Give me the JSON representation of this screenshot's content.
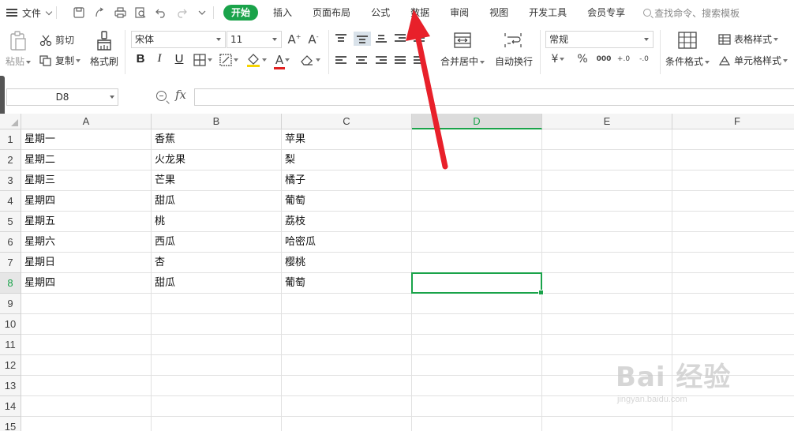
{
  "menubar": {
    "file_label": "文件",
    "tabs": [
      "开始",
      "插入",
      "页面布局",
      "公式",
      "数据",
      "审阅",
      "视图",
      "开发工具",
      "会员专享"
    ],
    "search_placeholder": "查找命令、搜索模板"
  },
  "ribbon": {
    "paste_label": "粘贴",
    "cut_label": "剪切",
    "copy_label": "复制",
    "format_painter_label": "格式刷",
    "font_name": "宋体",
    "font_size": "11",
    "bold": "B",
    "italic": "I",
    "underline": "U",
    "font_color_glyph": "A",
    "grow_font": "A+",
    "shrink_font": "A-",
    "merge_label": "合并居中",
    "wrap_label": "自动换行",
    "number_format": "常规",
    "currency_glyph": "¥",
    "percent_glyph": "%",
    "thousands_glyph": "000",
    "inc_decimal_glyph": "+.0",
    "dec_decimal_glyph": "-.0",
    "cond_format_label": "条件格式",
    "table_style_label": "表格样式",
    "cell_style_label": "单元格样式"
  },
  "formula_bar": {
    "name_box": "D8",
    "fx_glyph": "fx",
    "formula": ""
  },
  "sheet": {
    "columns": [
      "A",
      "B",
      "C",
      "D",
      "E",
      "F"
    ],
    "active_column": "D",
    "rows": [
      {
        "num": "1",
        "cells": [
          "星期一",
          "香蕉",
          "苹果"
        ]
      },
      {
        "num": "2",
        "cells": [
          "星期二",
          "火龙果",
          "梨"
        ]
      },
      {
        "num": "3",
        "cells": [
          "星期三",
          "芒果",
          "橘子"
        ]
      },
      {
        "num": "4",
        "cells": [
          "星期四",
          "甜瓜",
          "葡萄"
        ]
      },
      {
        "num": "5",
        "cells": [
          "星期五",
          "桃",
          "荔枝"
        ]
      },
      {
        "num": "6",
        "cells": [
          "星期六",
          "西瓜",
          "哈密瓜"
        ]
      },
      {
        "num": "7",
        "cells": [
          "星期日",
          "杏",
          "樱桃"
        ]
      },
      {
        "num": "8",
        "cells": [
          "星期四",
          "甜瓜",
          "葡萄"
        ]
      },
      {
        "num": "9",
        "cells": []
      },
      {
        "num": "10",
        "cells": []
      },
      {
        "num": "11",
        "cells": []
      },
      {
        "num": "12",
        "cells": []
      },
      {
        "num": "13",
        "cells": []
      },
      {
        "num": "14",
        "cells": []
      },
      {
        "num": "15",
        "cells": []
      }
    ],
    "active_row": "8",
    "selected_cell": "D8"
  },
  "watermark": {
    "brand": "Bai 经验",
    "url": "jingyan.baidu.com"
  },
  "colors": {
    "accent_green": "#1aa34a",
    "annotation_red": "#e8202a"
  }
}
